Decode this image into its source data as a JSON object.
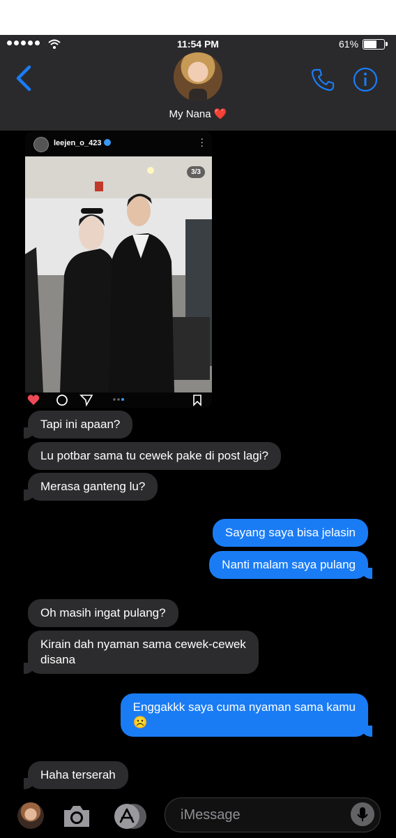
{
  "status_bar": {
    "time": "11:54 PM",
    "battery": "61%"
  },
  "header": {
    "contact_name": "My Nana",
    "heart": "❤️"
  },
  "post": {
    "username": "leejen_o_423",
    "counter": "3/3"
  },
  "messages": [
    {
      "text": "Tapi ini apaan?"
    },
    {
      "text": "Lu potbar sama tu cewek pake di post lagi?"
    },
    {
      "text": "Merasa ganteng lu?"
    },
    {
      "text": "Sayang saya bisa jelasin"
    },
    {
      "text": "Nanti malam saya pulang"
    },
    {
      "text": "Oh masih ingat pulang?"
    },
    {
      "text": "Kirain dah nyaman sama cewek-cewek\ndisana"
    },
    {
      "text": "Enggakkk saya cuma nyaman sama kamu\n☹️"
    },
    {
      "text": "Haha terserah"
    }
  ],
  "composer": {
    "placeholder": "iMessage"
  },
  "colors": {
    "outgoing": "#1a7cf5",
    "incoming": "#2c2c2e",
    "accent": "#1a7cf5",
    "header_bg": "#2a2a2c"
  }
}
